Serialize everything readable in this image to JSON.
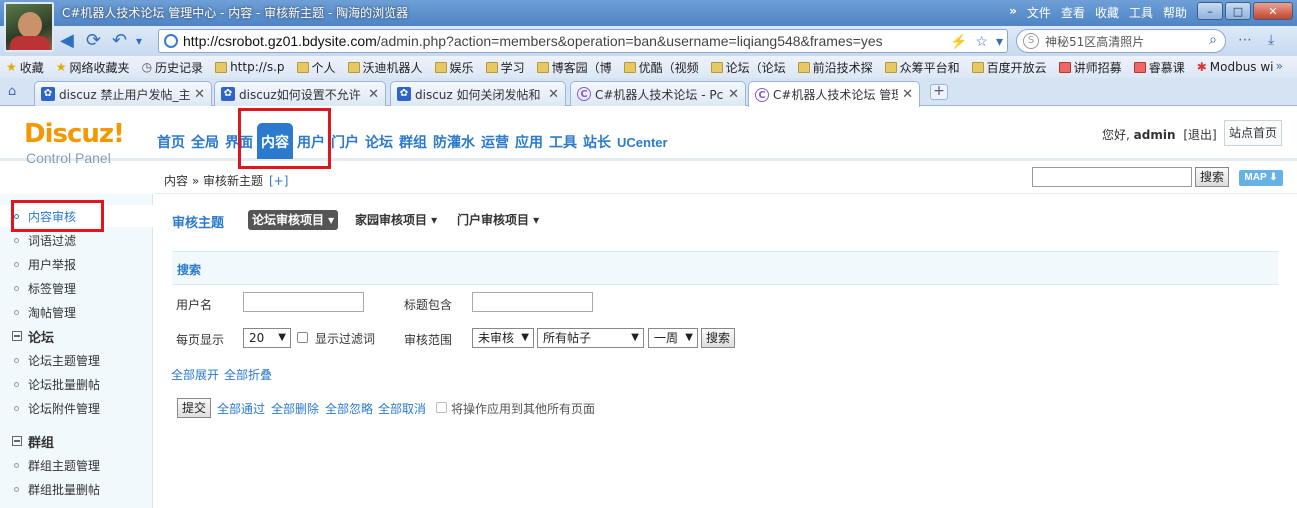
{
  "browser": {
    "window_title": "C#机器人技术论坛 管理中心 - 内容 - 审核新主题 - 陶海的浏览器",
    "menu": {
      "double_arrow": "»",
      "file": "文件",
      "view": "查看",
      "favorites": "收藏",
      "tools": "工具",
      "help": "帮助"
    },
    "url_host": "http://csrobot.gz01.bdysite.com",
    "url_path": "/admin.php?action=members&operation=ban&username=liqiang548&frames=yes",
    "search_text": "神秘51区高清照片",
    "bookmarks": [
      "收藏",
      "网络收藏夹",
      "历史记录",
      "http://s.p",
      "个人",
      "沃迪机器人",
      "娱乐",
      "学习",
      "博客园（博",
      "优酷（视频",
      "论坛（论坛",
      "前沿技术探",
      "众筹平台和",
      "百度开放云",
      "讲师招募",
      "睿慕课",
      "Modbus wi"
    ],
    "tabs": [
      {
        "label": "discuz 禁止用户发帖_主"
      },
      {
        "label": "discuz如何设置不允许"
      },
      {
        "label": "discuz 如何关闭发帖和"
      },
      {
        "label": "C#机器人技术论坛 - Pc"
      },
      {
        "label": "C#机器人技术论坛 管理"
      }
    ]
  },
  "header": {
    "logo": "Discuz!",
    "logo_sub": "Control Panel",
    "nav": [
      "首页",
      "全局",
      "界面",
      "内容",
      "用户",
      "门户",
      "论坛",
      "群组",
      "防灌水",
      "运营",
      "应用",
      "工具",
      "站长",
      "UCenter"
    ],
    "greeting": "您好,",
    "username": "admin",
    "logout": "[退出]",
    "site_home": "站点首页"
  },
  "crumb": {
    "text": "内容 » 审核新主题",
    "plus": "[+]",
    "search_btn": "搜索",
    "map_btn": "MAP ⬇"
  },
  "sidebar": {
    "items": [
      "内容审核",
      "词语过滤",
      "用户举报",
      "标签管理",
      "淘帖管理"
    ],
    "group_forum": "论坛",
    "forum_items": [
      "论坛主题管理",
      "论坛批量删帖",
      "论坛附件管理"
    ],
    "group_group": "群组",
    "group_items": [
      "群组主题管理",
      "群组批量删帖"
    ]
  },
  "main": {
    "title": "审核主题",
    "subtabs": [
      "论坛审核项目 ▾",
      "家园审核项目 ▾",
      "门户审核项目 ▾"
    ],
    "search_head": "搜索",
    "username_label": "用户名",
    "title_contains_label": "标题包含",
    "per_page_label": "每页显示",
    "per_page_value": "20",
    "show_filter_label": "显示过滤词",
    "scope_label": "审核范围",
    "scope_status": "未审核",
    "scope_posts": "所有帖子",
    "scope_time": "一周",
    "search_btn": "搜索",
    "expand_all": "全部展开",
    "collapse_all": "全部折叠",
    "submit_btn": "提交",
    "approve_all": "全部通过",
    "delete_all": "全部删除",
    "ignore_all": "全部忽略",
    "cancel_all": "全部取消",
    "apply_all_pages": "将操作应用到其他所有页面"
  },
  "colors": {
    "accent": "#2b7acd",
    "logo": "#f39800",
    "annotation": "#e0151d"
  }
}
